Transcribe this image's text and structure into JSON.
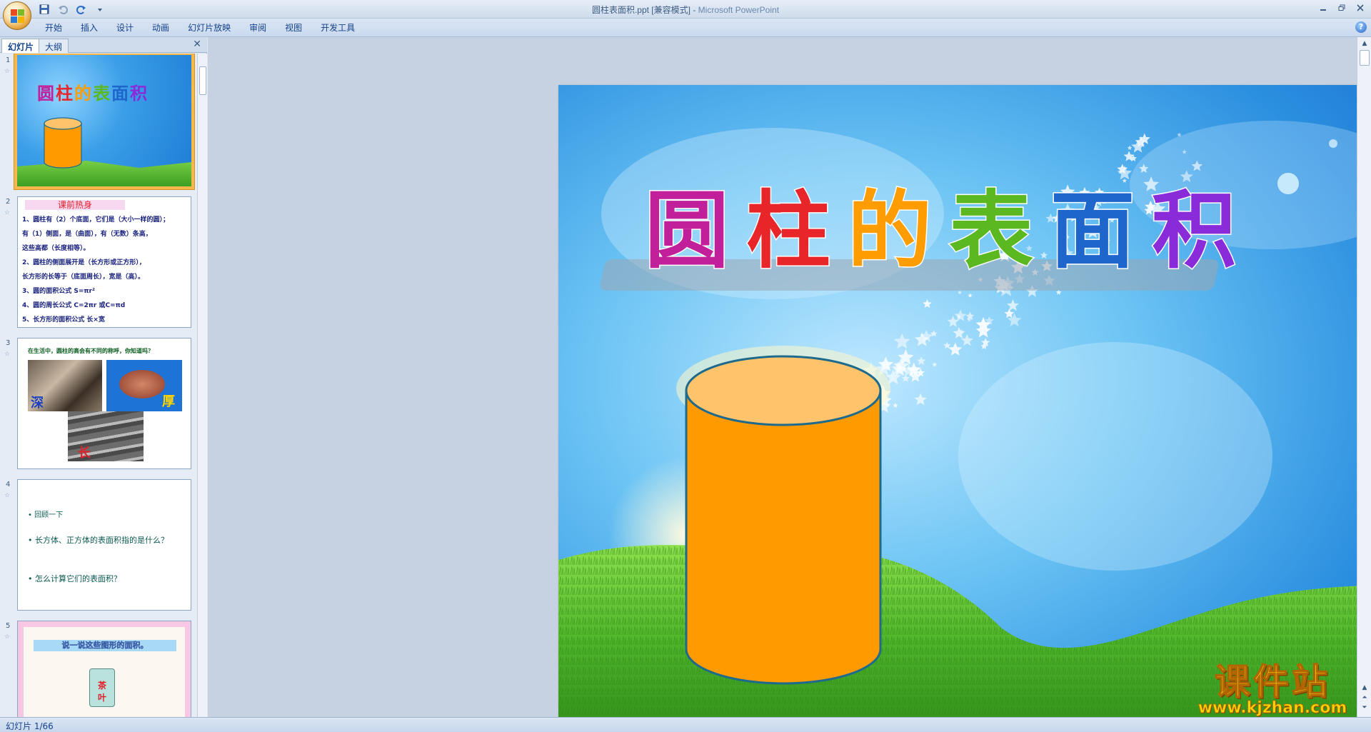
{
  "window": {
    "title_doc": "圆柱表面积.ppt [兼容模式]",
    "title_sep": " - ",
    "title_app": "Microsoft PowerPoint"
  },
  "ribbon": {
    "tabs": [
      "开始",
      "插入",
      "设计",
      "动画",
      "幻灯片放映",
      "审阅",
      "视图",
      "开发工具"
    ]
  },
  "left_pane": {
    "tab_slides": "幻灯片",
    "tab_outline": "大纲",
    "slides": [
      {
        "num": "1",
        "title": "圆柱的表面积"
      },
      {
        "num": "2",
        "heading": "课前热身",
        "lines": [
          "1、圆柱有（2）个底面，它们是（大小一样的圆）；",
          "有（1）侧面，是（曲面），有（无数）条高，",
          "这些高都（长度相等）。",
          "2、圆柱的侧面展开是（长方形或正方形），",
          "长方形的长等于（底面周长），宽是（高）。",
          "3、圆的面积公式 S=πr²",
          "4、圆的周长公式 C=2πr 或C=πd",
          "5、长方形的面积公式 长×宽"
        ]
      },
      {
        "num": "3",
        "caption": "在生活中，圆柱的高会有不同的称呼，你知道吗？",
        "w1": "深",
        "w2": "厚",
        "w3": "长"
      },
      {
        "num": "4",
        "bullets": [
          "回顾一下",
          "长方体、正方体的表面积指的是什么？",
          "怎么计算它们的表面积？"
        ]
      },
      {
        "num": "5",
        "bar": "说一说这些图形的面积。",
        "can_label": "茶叶"
      }
    ]
  },
  "slide": {
    "title_chars": [
      "圆",
      "柱",
      "的",
      "表",
      "面",
      "积"
    ],
    "title_colors": [
      "#c21f9a",
      "#e8262a",
      "#ff9d00",
      "#5cb820",
      "#1f66cc",
      "#8a2bd9"
    ],
    "cylinder_color": "#ff9a00",
    "cylinder_top_color": "#ffc46b"
  },
  "status": {
    "slide_indicator": "幻灯片 1/66"
  },
  "watermark": {
    "big": "课件站",
    "small": "www.kjzhan.com"
  }
}
